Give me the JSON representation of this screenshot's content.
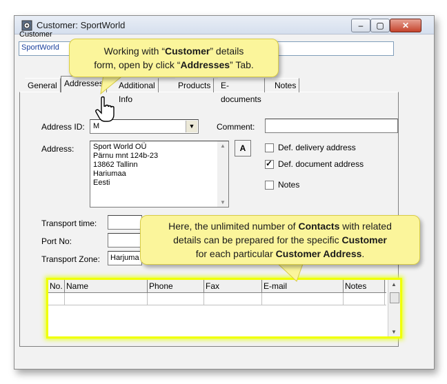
{
  "window": {
    "title": "Customer: SportWorld",
    "buttons": {
      "minimize": "–",
      "maximize": "▢",
      "close": "✕"
    }
  },
  "customer": {
    "label": "Customer",
    "value": "SportWorld"
  },
  "tabs": [
    {
      "label": "General",
      "active": false
    },
    {
      "label": "Addresses",
      "active": true
    },
    {
      "label": "Additional Info",
      "active": false
    },
    {
      "label": "Products",
      "active": false
    },
    {
      "label": "E-documents",
      "active": false
    },
    {
      "label": "Notes",
      "active": false
    }
  ],
  "address_panel": {
    "address_id_label": "Address ID:",
    "address_id_value": "M",
    "comment_label": "Comment:",
    "comment_value": "",
    "address_label": "Address:",
    "address_lines": [
      "Sport World OÜ",
      "Pärnu mnt 124b-23",
      "13862 Tallinn",
      "Hariumaa",
      "Eesti"
    ],
    "font_button": "A",
    "checkboxes": [
      {
        "label": "Def. delivery address",
        "checked": false
      },
      {
        "label": "Def. document address",
        "checked": true
      },
      {
        "label": "Notes",
        "checked": false
      }
    ],
    "transport_time_label": "Transport time:",
    "port_no_label": "Port No:",
    "transport_zone_label": "Transport Zone:",
    "transport_zone_value": "Harjuma"
  },
  "contacts_grid": {
    "columns": [
      "No.",
      "Name",
      "Phone",
      "Fax",
      "E-mail",
      "Notes"
    ]
  },
  "callouts": {
    "top": {
      "line1_pre": "Working with “",
      "line1_b": "Customer",
      "line1_post": "” details",
      "line2_pre": "form, open by click “",
      "line2_b": "Addresses",
      "line2_post": "” Tab."
    },
    "bottom": {
      "line1_pre": "Here, the unlimited number of ",
      "line1_b": "Contacts",
      "line1_post": " with related",
      "line2_pre": "details can be prepared for the specific ",
      "line2_b": "Customer",
      "line3_pre": "for each particular ",
      "line3_b": "Customer Address",
      "line3_post": "."
    }
  },
  "colors": {
    "callout_bg": "#fbf59b",
    "highlight": "#f0ff00",
    "link_text": "#1a3f9c"
  }
}
